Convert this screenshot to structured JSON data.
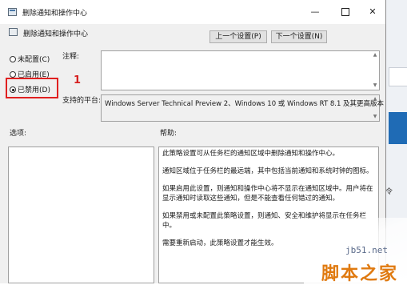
{
  "window": {
    "title": "删除通知和操作中心",
    "minimize": "—",
    "close": "✕"
  },
  "header": {
    "setting_title": "删除通知和操作中心",
    "prev_button": "上一个设置(P)",
    "next_button": "下一个设置(N)"
  },
  "radios": [
    {
      "label": "未配置(C)",
      "selected": false
    },
    {
      "label": "已启用(E)",
      "selected": false
    },
    {
      "label": "已禁用(D)",
      "selected": true
    }
  ],
  "annotation": {
    "step": "1",
    "color": "#e02020"
  },
  "labels": {
    "comment": "注释:",
    "supported_platforms": "支持的平台:",
    "options": "选项:",
    "help": "帮助:"
  },
  "supported_platforms_value": "Windows Server Technical Preview 2、Windows 10 或 Windows RT 8.1 及其更高版本",
  "help_text": [
    "此策略设置可从任务栏的通知区域中删除通知和操作中心。",
    "通知区域位于任务栏的最远端，其中包括当前通知和系统时钟的图标。",
    "如果启用此设置，则通知和操作中心将不显示在通知区域中。用户将在显示通知时读取这些通知，但是不能查看任何错过的通知。",
    "如果禁用或未配置此策略设置，则通知、安全和维护将显示在任务栏中。",
    "需要重新启动，此策略设置才能生效。"
  ],
  "watermark": {
    "site": "jb51.net",
    "brand": "脚本之家"
  },
  "background_text": "令"
}
